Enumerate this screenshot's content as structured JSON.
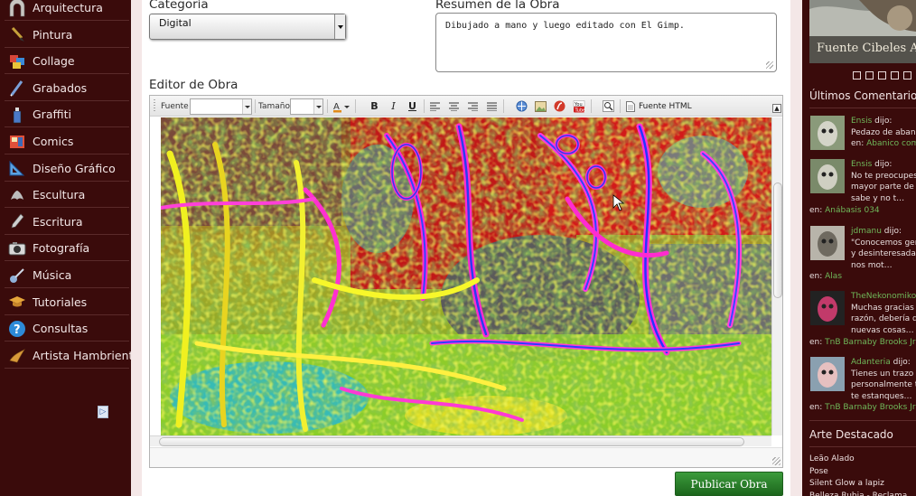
{
  "sidebar": {
    "items": [
      {
        "label": "Arquitectura",
        "icon": "arch-icon"
      },
      {
        "label": "Pintura",
        "icon": "brush-icon"
      },
      {
        "label": "Collage",
        "icon": "collage-icon"
      },
      {
        "label": "Grabados",
        "icon": "burin-icon"
      },
      {
        "label": "Graffiti",
        "icon": "spray-can-icon"
      },
      {
        "label": "Comics",
        "icon": "comic-icon"
      },
      {
        "label": "Diseño Gráfico",
        "icon": "set-square-icon"
      },
      {
        "label": "Escultura",
        "icon": "sculpture-icon"
      },
      {
        "label": "Escritura",
        "icon": "pen-icon"
      },
      {
        "label": "Fotografía",
        "icon": "camera-icon"
      },
      {
        "label": "Música",
        "icon": "guitar-icon"
      },
      {
        "label": "Tutoriales",
        "icon": "graduation-cap-icon"
      },
      {
        "label": "Consultas",
        "icon": "question-icon"
      },
      {
        "label": "Artista Hambriento",
        "icon": "hungry-artist-icon"
      }
    ],
    "ad_badge": "▷"
  },
  "form": {
    "category_label": "Categoría",
    "category_value": "Digital",
    "summary_label": "Resumen de la Obra",
    "summary_value": "Dibujado a mano y luego editado con El Gimp.",
    "editor_label": "Editor de Obra",
    "publish_label": "Publicar Obra"
  },
  "toolbar": {
    "font_label": "Fuente",
    "size_label": "Tamaño",
    "bold": "B",
    "italic": "I",
    "underline": "U",
    "source_label": "Fuente HTML",
    "collapse": "▲"
  },
  "right": {
    "featured_caption": "Fuente Cibeles A",
    "comments_title": "Últimos Comentarios",
    "comments": [
      {
        "user": "Ensis",
        "said": " dijo:",
        "lines": [
          "Pedazo de abani"
        ],
        "on_label": "en: ",
        "on_work": "Abanico com"
      },
      {
        "user": "Ensis",
        "said": " dijo:",
        "lines": [
          "No te preocupes",
          "mayor parte de l",
          "sabe y no t…"
        ],
        "on_label": "en: ",
        "on_work": "Anábasis 034"
      },
      {
        "user": "jdmanu",
        "said": " dijo:",
        "lines": [
          "\"Conocemos gen",
          "y desinteresada,",
          "nos mot…"
        ],
        "on_label": "en: ",
        "on_work": "Alas"
      },
      {
        "user": "TheNekonomiko",
        "said": "",
        "lines": [
          "Muchas gracias",
          "razón, debería de",
          "nuevas cosas…"
        ],
        "on_label": "en: ",
        "on_work": "TnB Barnaby Brooks Jr"
      },
      {
        "user": "Adanteria",
        "said": " dijo:",
        "lines": [
          "Tienes un trazo",
          "personalmente te",
          "te estanques…"
        ],
        "on_label": "en: ",
        "on_work": "TnB Barnaby Brooks Jr"
      }
    ],
    "featured_title": "Arte Destacado",
    "featured_art": [
      "Leão Alado",
      "Pose",
      "Silent Glow a lapiz",
      "Belleza Rubia - Reclama"
    ]
  },
  "colors": {
    "sidebar_bg": "#3a0b0b",
    "link_green": "#6fb85a",
    "publish_green": "#2a7f2a"
  }
}
